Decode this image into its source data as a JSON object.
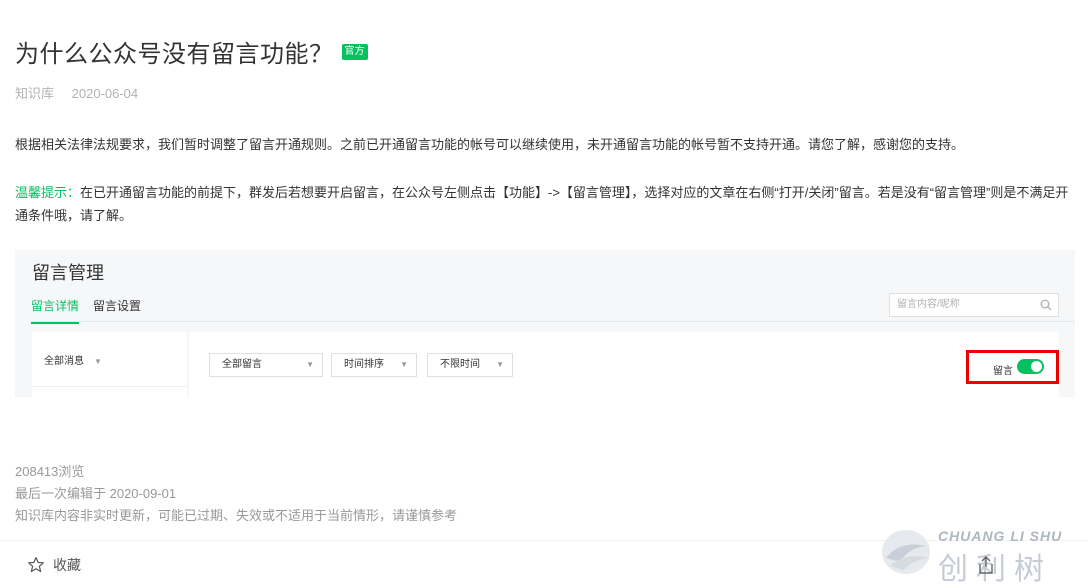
{
  "article": {
    "title": "为什么公众号没有留言功能？",
    "badge": "官方",
    "category": "知识库",
    "date": "2020-06-04",
    "paragraph1": "根据相关法律法规要求，我们暂时调整了留言开通规则。之前已开通留言功能的帐号可以继续使用，未开通留言功能的帐号暂不支持开通。请您了解，感谢您的支持。",
    "tip_label": "温馨提示：",
    "tip_text": "在已开通留言功能的前提下，群发后若想要开启留言，在公众号左侧点击【功能】->【留言管理】，选择对应的文章在右侧“打开/关闭”留言。若是没有“留言管理”则是不满足开通条件哦，请了解。"
  },
  "screenshot": {
    "title": "留言管理",
    "tabs": [
      "留言详情",
      "留言设置"
    ],
    "search_placeholder": "留言内容/昵称",
    "left_select": "全部消息",
    "filters": [
      "全部留言",
      "时间排序",
      "不限时间"
    ],
    "toggle_label": "留言",
    "toggle_on": true
  },
  "stats": {
    "views": "208413浏览",
    "edited": "最后一次编辑于  2020-09-01",
    "disclaimer": "知识库内容非实时更新，可能已过期、失效或不适用于当前情形，请谨慎参考"
  },
  "footer": {
    "favorite_label": "收藏",
    "icons": [
      "star-icon",
      "share-icon"
    ]
  },
  "watermark": {
    "en": "CHUANG LI SHU",
    "cn": "创利树"
  },
  "colors": {
    "accent": "#07c160",
    "highlight_border": "#ee0000"
  }
}
